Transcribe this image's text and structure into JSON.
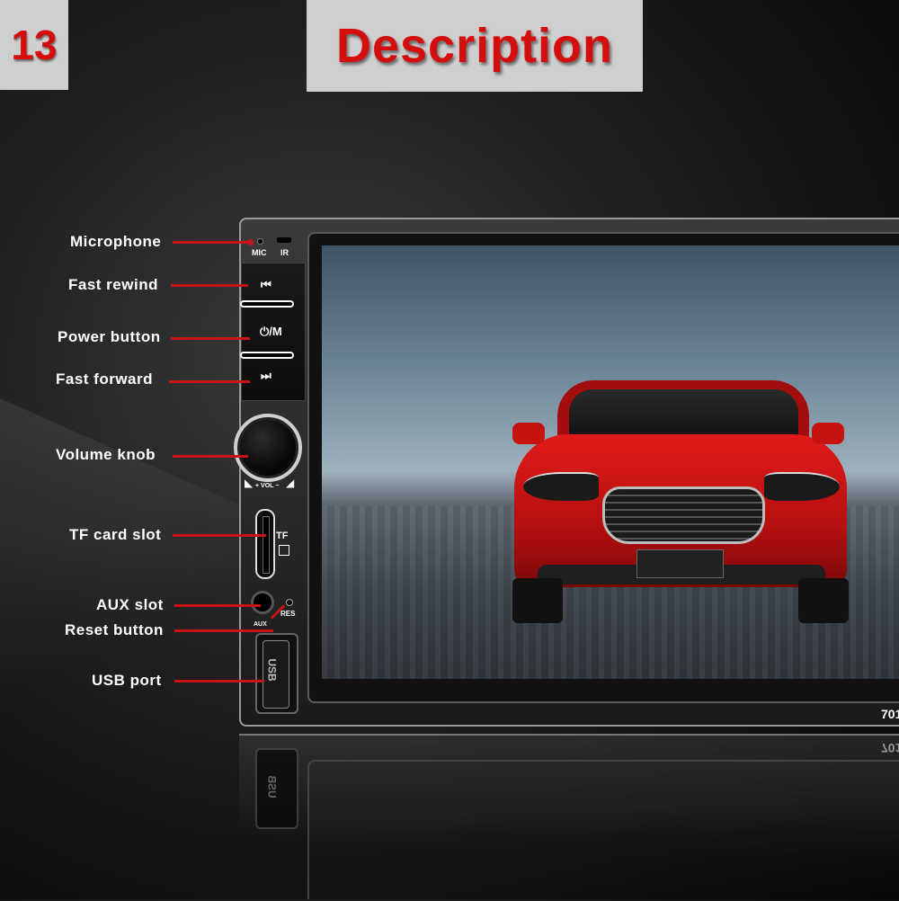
{
  "badge": {
    "number": "13"
  },
  "title": "Description",
  "labels": {
    "microphone": "Microphone",
    "fast_rewind": "Fast rewind",
    "power_button": "Power button",
    "fast_forward": "Fast forward",
    "volume_knob": "Volume knob",
    "tf_card_slot": "TF card slot",
    "aux_slot": "AUX slot",
    "reset_button": "Reset button",
    "usb_port": "USB port"
  },
  "panel": {
    "mic": "MIC",
    "ir": "IR",
    "rewind_icon": "⏮",
    "power_icon": "⏻/M",
    "forward_icon": "⏭",
    "vol": "+ VOL −",
    "tf": "TF",
    "aux": "AUX",
    "res": "RES",
    "usb": "USB"
  },
  "model": "701",
  "colors": {
    "accent_red": "#d40d0d",
    "leader_line": "#c81414",
    "title_bg": "#cfcfcf"
  }
}
